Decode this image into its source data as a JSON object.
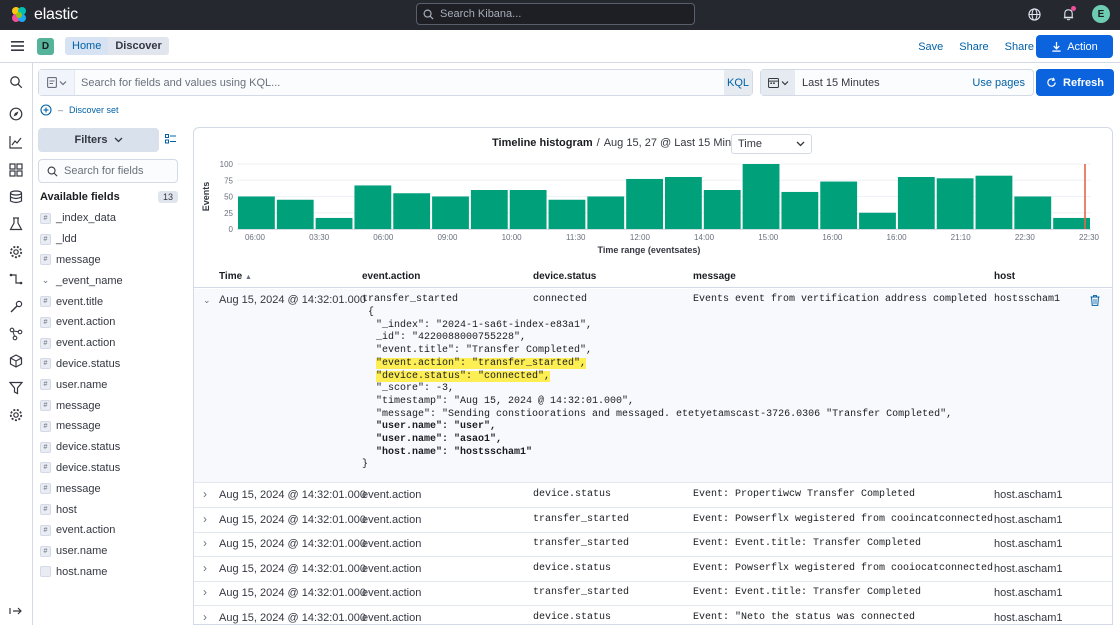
{
  "topbar": {
    "brand": "elastic",
    "search_placeholder": "Search Kibana...",
    "avatar_initial": "E"
  },
  "header": {
    "space_initial": "D",
    "crumbs": [
      "Home",
      "Discover"
    ],
    "links": [
      "Save",
      "Share",
      "Share"
    ],
    "action_label": "Action"
  },
  "query": {
    "placeholder": "Search for fields and values using KQL...",
    "lang": "KQL",
    "date_range": "Last 15 Minutes",
    "use_pages": "Use pages",
    "refresh_label": "Refresh",
    "discover_set": "Discover set"
  },
  "sidebar": {
    "filters_label": "Filters",
    "search_placeholder": "Search for fields",
    "available_label": "Available fields",
    "available_count": "13",
    "fields": [
      {
        "type": "#",
        "name": "_index_data"
      },
      {
        "type": "#",
        "name": "_ldd"
      },
      {
        "type": "#",
        "name": "message"
      },
      {
        "type": "chev",
        "name": "_event_name"
      },
      {
        "type": "#",
        "name": "event.title"
      },
      {
        "type": "#",
        "name": "event.action"
      },
      {
        "type": "#",
        "name": "event.action"
      },
      {
        "type": "#",
        "name": "device.status"
      },
      {
        "type": "#",
        "name": "user.name"
      },
      {
        "type": "#",
        "name": "message"
      },
      {
        "type": "#",
        "name": "message"
      },
      {
        "type": "#",
        "name": "device.status"
      },
      {
        "type": "#",
        "name": "device.status"
      },
      {
        "type": "#",
        "name": "message"
      },
      {
        "type": "#",
        "name": "host"
      },
      {
        "type": "#",
        "name": "event.action"
      },
      {
        "type": "#",
        "name": "user.name"
      },
      {
        "type": "",
        "name": "host.name"
      }
    ]
  },
  "histogram": {
    "title": "Timeline histogram",
    "subtitle": "Aug 15, 27 @ Last 15 Minutes",
    "interval": "Time",
    "ylabel": "Events",
    "xlabel": "Time range (eventsates)"
  },
  "chart_data": {
    "type": "bar",
    "ylabel": "Events",
    "xlabel": "Time range (eventsates)",
    "ylim": [
      0,
      100
    ],
    "yticks": [
      0,
      25,
      50,
      75,
      100
    ],
    "tick_labels": [
      "06:00",
      "03:30",
      "06:00",
      "09:00",
      "10:00",
      "11:30",
      "12:00",
      "14:00",
      "15:00",
      "16:00",
      "16:00",
      "21:10",
      "22:30",
      "22:30"
    ],
    "values": [
      50,
      45,
      17,
      67,
      55,
      50,
      60,
      60,
      45,
      50,
      77,
      80,
      60,
      100,
      57,
      73,
      25,
      80,
      78,
      82,
      50,
      17
    ],
    "color": "#00a07a"
  },
  "table": {
    "columns": [
      "Time",
      "event.action",
      "device.status",
      "message",
      "host"
    ],
    "expanded": {
      "time": "Aug 15, 2024 @ 14:32:01.000",
      "action": "transfer_started",
      "status": "connected",
      "message": "Events event from vertification address completed",
      "host": "hostsscham1",
      "json_lines": [
        {
          "text": "{",
          "indent": 0,
          "hl": false,
          "bold_key": false
        },
        {
          "text": "\"_index\": \"2024-1-sa6t-index-e83a1\",",
          "indent": 1,
          "hl": false,
          "bold_key": false
        },
        {
          "text": "_id\": \"4220088000755228\",",
          "indent": 1,
          "hl": false,
          "bold_key": false
        },
        {
          "text": "\"event.title\": \"Transfer Completed\",",
          "indent": 1,
          "hl": false,
          "bold_key": false
        },
        {
          "text": "\"event.action\": \"transfer_started\",",
          "indent": 1,
          "hl": true,
          "bold_key": false
        },
        {
          "text": "\"device.status\": \"connected\",",
          "indent": 1,
          "hl": true,
          "bold_key": false
        },
        {
          "text": "\"_score\": -3,",
          "indent": 1,
          "hl": false,
          "bold_key": false
        },
        {
          "text": "\"timestamp\": \"Aug 15, 2024 @ 14:32:01.000\",",
          "indent": 1,
          "hl": false,
          "bold_key": false
        },
        {
          "text": "\"message\": \"Sending constioorations and messaged. etetyetamscast-3726.0306 \"Transfer Completed\",",
          "indent": 1,
          "hl": false,
          "bold_key": false
        },
        {
          "text": "\"user.name\": \"user\",",
          "indent": 1,
          "hl": false,
          "bold_key": true
        },
        {
          "text": "\"user.name\": \"asao1\",",
          "indent": 1,
          "hl": false,
          "bold_key": true
        },
        {
          "text": "\"host.name\": \"hostsscham1\"",
          "indent": 1,
          "hl": false,
          "bold_key": true
        },
        {
          "text": "}",
          "indent": 0,
          "hl": false,
          "bold_key": false
        }
      ]
    },
    "rows": [
      {
        "time": "Aug 15, 2024 @ 14:32:01.000",
        "action": "event.action",
        "status": "device.status",
        "message": "Event: Propertiwcw Transfer Completed",
        "host": "host.ascham1"
      },
      {
        "time": "Aug 15, 2024 @ 14:32:01.000",
        "action": "event.action",
        "status": "transfer_started",
        "message": "Event: Powserflx wegistered from cooincatconnected",
        "host": "host.ascham1"
      },
      {
        "time": "Aug 15, 2024 @ 14:32:01.000",
        "action": "event.action",
        "status": "transfer_started",
        "message": "Event: Event.title: Transfer Completed",
        "host": "host.ascham1"
      },
      {
        "time": "Aug 15, 2024 @ 14:32:01.000",
        "action": "event.action",
        "status": "device.status",
        "message": "Event: Powserflx wegistered from cooiocatconnected",
        "host": "host.ascham1"
      },
      {
        "time": "Aug 15, 2024 @ 14:32:01.000",
        "action": "event.action",
        "status": "transfer_started",
        "message": "Event: Event.title: Transfer Completed",
        "host": "host.ascham1"
      },
      {
        "time": "Aug 15, 2024 @ 14:32:01.000",
        "action": "event.action",
        "status": "device.status",
        "message": "Event: \"Neto the status was connected",
        "host": "host.ascham1"
      }
    ]
  }
}
